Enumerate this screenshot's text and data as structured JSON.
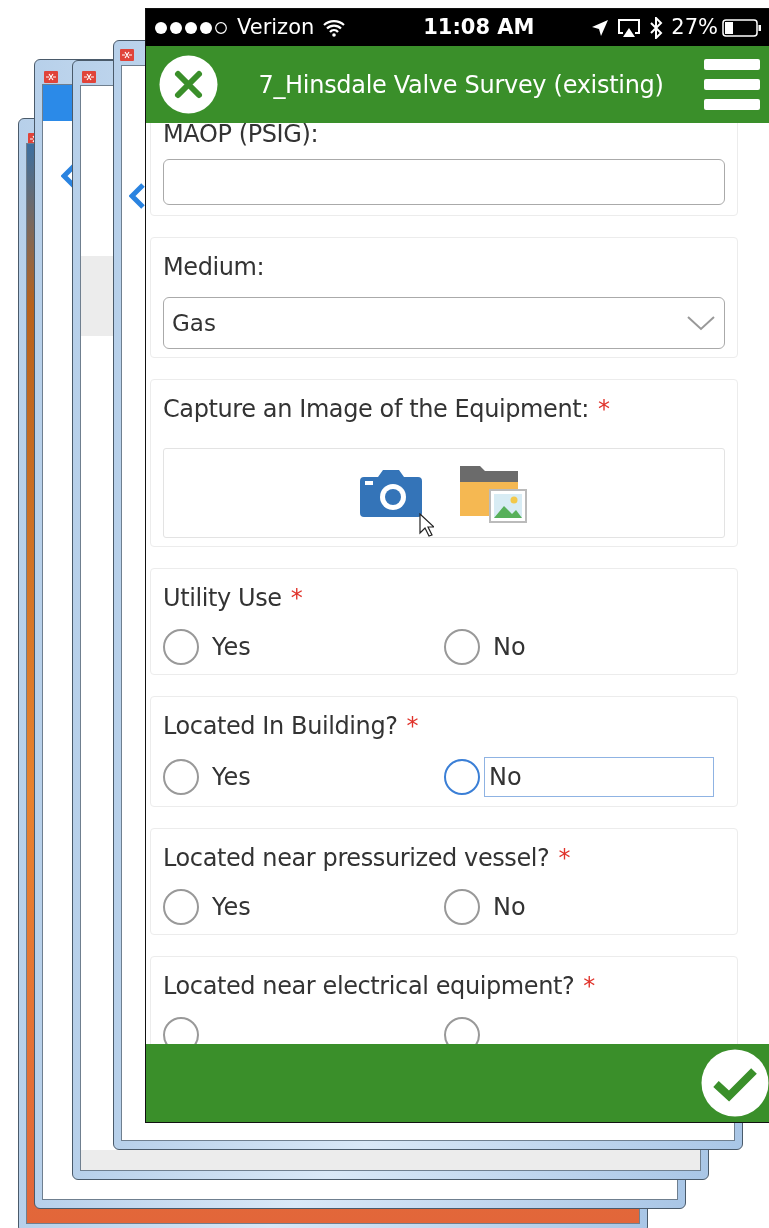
{
  "status_bar": {
    "carrier": "Verizon",
    "time": "11:08 AM",
    "battery": "27%"
  },
  "header": {
    "title": "7_Hinsdale Valve Survey (existing)"
  },
  "fields": [
    {
      "kind": "text",
      "label": "MAOP (PSIG):"
    },
    {
      "kind": "select",
      "label": "Medium:",
      "value": "Gas"
    },
    {
      "kind": "image",
      "label": "Capture an Image of the Equipment:",
      "required_mark": "*"
    },
    {
      "kind": "radio",
      "label": "Utility Use",
      "required_mark": "*",
      "options": [
        {
          "label": "Yes",
          "selected": false,
          "focused": false
        },
        {
          "label": "No",
          "selected": false,
          "focused": false
        }
      ]
    },
    {
      "kind": "radio",
      "label": "Located In Building?",
      "required_mark": "*",
      "options": [
        {
          "label": "Yes",
          "selected": false,
          "focused": false
        },
        {
          "label": "No",
          "selected": false,
          "focused": true
        }
      ]
    },
    {
      "kind": "radio",
      "label": "Located near pressurized vessel?",
      "required_mark": "*",
      "options": [
        {
          "label": "Yes",
          "selected": false,
          "focused": false
        },
        {
          "label": "No",
          "selected": false,
          "focused": false
        }
      ]
    },
    {
      "kind": "radio",
      "label": "Located near electrical equipment?",
      "required_mark": "*",
      "options": [
        {
          "selected": false,
          "focused": false
        },
        {
          "selected": false,
          "focused": false
        }
      ]
    }
  ]
}
